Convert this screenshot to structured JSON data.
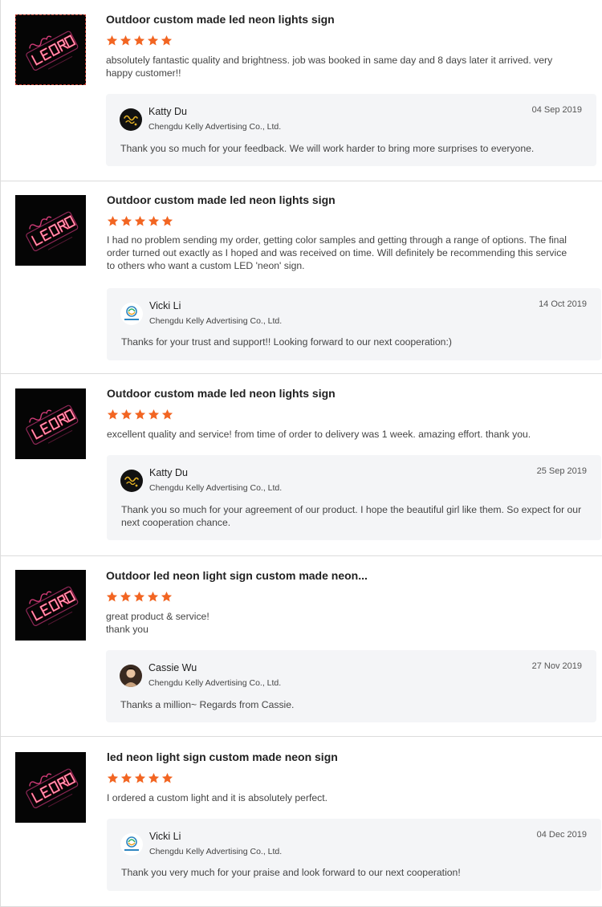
{
  "reviews": [
    {
      "product_title": "Outdoor custom made led neon lights sign",
      "rating": 5,
      "text": "absolutely fantastic quality and brightness. job was booked in same day and 8 days later it arrived. very happy customer!!",
      "reply": {
        "name": "Katty Du",
        "company": "Chengdu Kelly Advertising Co., Ltd.",
        "date": "04 Sep 2019",
        "text": "Thank you so much for your feedback.  We will work harder to bring more surprises to everyone.",
        "avatar_icon": "gold-script-avatar-icon"
      }
    },
    {
      "product_title": "Outdoor custom made led neon lights sign",
      "rating": 5,
      "text": "I had no problem sending my order, getting color samples and getting through a range of options. The final order turned out exactly as I hoped and was received on time. Will definitely be recommending this service to others who want a custom LED 'neon' sign.",
      "reply": {
        "name": "Vicki Li",
        "company": "Chengdu Kelly Advertising Co., Ltd.",
        "date": "14 Oct 2019",
        "text": "Thanks for your trust and support!! Looking forward to our next cooperation:)",
        "avatar_icon": "blue-logo-avatar-icon"
      }
    },
    {
      "product_title": "Outdoor custom made led neon lights sign",
      "rating": 5,
      "text": "excellent quality and service! from time of order to delivery was 1 week. amazing effort. thank you.",
      "reply": {
        "name": "Katty Du",
        "company": "Chengdu Kelly Advertising Co., Ltd.",
        "date": "25 Sep 2019",
        "text": "Thank you so much for your  agreement of our product. I hope the beautiful girl like them. So expect for our next cooperation chance.",
        "avatar_icon": "gold-script-avatar-icon"
      }
    },
    {
      "product_title": "Outdoor led neon light sign custom made neon...",
      "rating": 5,
      "text_lines": [
        "great product & service!",
        "thank you"
      ],
      "reply": {
        "name": "Cassie Wu",
        "company": "Chengdu Kelly Advertising Co., Ltd.",
        "date": "27 Nov 2019",
        "text": "Thanks a million~ Regards from Cassie.",
        "avatar_icon": "portrait-avatar-icon"
      }
    },
    {
      "product_title": "led neon light sign custom made neon sign",
      "rating": 5,
      "text": "I ordered a custom light and it is absolutely perfect.",
      "reply": {
        "name": "Vicki Li",
        "company": "Chengdu Kelly Advertising Co., Ltd.",
        "date": "04 Dec 2019",
        "text": "Thank you very much for your praise and look forward to our next cooperation!",
        "avatar_icon": "blue-logo-avatar-icon"
      }
    }
  ],
  "colors": {
    "star": "#f26522",
    "reply_bg": "#f4f5f7",
    "neon": "#ff3b6b"
  }
}
